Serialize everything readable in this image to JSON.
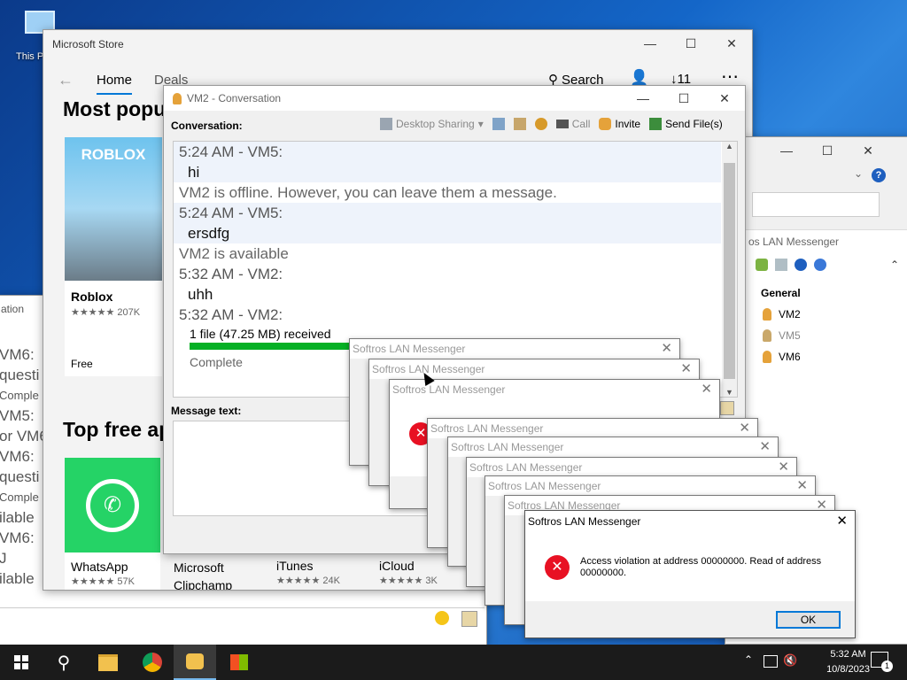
{
  "desktop": {
    "this_pc_label": "This P"
  },
  "store": {
    "title": "Microsoft Store",
    "tabs": [
      "Home",
      "Deals"
    ],
    "search_label": "Search",
    "downloads": "11",
    "section1": "Most popu",
    "section2": "Top free ap",
    "apps_top": [
      {
        "name": "Roblox",
        "rating": "207K",
        "price": "Free",
        "logo": "ROBLOX"
      }
    ],
    "apps_bottom": [
      {
        "name": "WhatsApp",
        "rating": "57K"
      },
      {
        "name": "Microsoft Clipchamp",
        "rating": ""
      },
      {
        "name": "iTunes",
        "rating": "24K"
      },
      {
        "name": "iCloud",
        "rating": "3K"
      }
    ]
  },
  "bg_conversation": {
    "title": "ation",
    "lines": [
      "VM6:",
      "questi",
      "Comple",
      "VM5:",
      "or VM6",
      "VM6:",
      "questi",
      "Comple",
      "ilable",
      "VM6:",
      "J",
      "ilable"
    ]
  },
  "conversation": {
    "title": "VM2 - Conversation",
    "conversation_label": "Conversation:",
    "toolbar": {
      "desktop_sharing": "Desktop Sharing",
      "call": "Call",
      "invite": "Invite",
      "send_files": "Send File(s)"
    },
    "messages": [
      {
        "kind": "hdr",
        "text": "5:24 AM - VM5:"
      },
      {
        "kind": "msg",
        "text": "hi"
      },
      {
        "kind": "sys",
        "text": "VM2 is offline. However, you can leave them a message."
      },
      {
        "kind": "hdr",
        "text": "5:24 AM - VM5:"
      },
      {
        "kind": "msg",
        "text": "ersdfg"
      },
      {
        "kind": "sys",
        "text": "VM2 is available"
      },
      {
        "kind": "hdr",
        "text": "5:32 AM - VM2:"
      },
      {
        "kind": "msg",
        "text": "uhh"
      },
      {
        "kind": "hdr",
        "text": "5:32 AM - VM2:"
      }
    ],
    "file_received": "1 file (47.25 MB) received",
    "file_status": "Complete",
    "file_progress": 1.0,
    "message_text_label": "Message text:"
  },
  "messenger": {
    "title": "os LAN Messenger",
    "group": "General",
    "contacts": [
      {
        "name": "VM2",
        "status": "online"
      },
      {
        "name": "VM5",
        "status": "offline"
      },
      {
        "name": "VM6",
        "status": "online"
      }
    ]
  },
  "error_dialog": {
    "title": "Softros LAN Messenger",
    "message": "Access violation at address 00000000. Read of address 00000000.",
    "ok_label": "OK"
  },
  "stacked_titles": [
    "Softros LAN Messenger",
    "Softros LAN Messenger",
    "Softros LAN Messenger",
    "Softros LAN Messenger",
    "Softros LAN Messenger",
    "Softros LAN Messenger",
    "Softros LAN Messenger",
    "Softros LAN Messenger"
  ],
  "taskbar": {
    "time": "5:32 AM",
    "date": "10/8/2023",
    "notification_count": "1"
  },
  "colors": {
    "accent": "#0078d7",
    "progress": "#06b025",
    "error": "#e81123"
  }
}
